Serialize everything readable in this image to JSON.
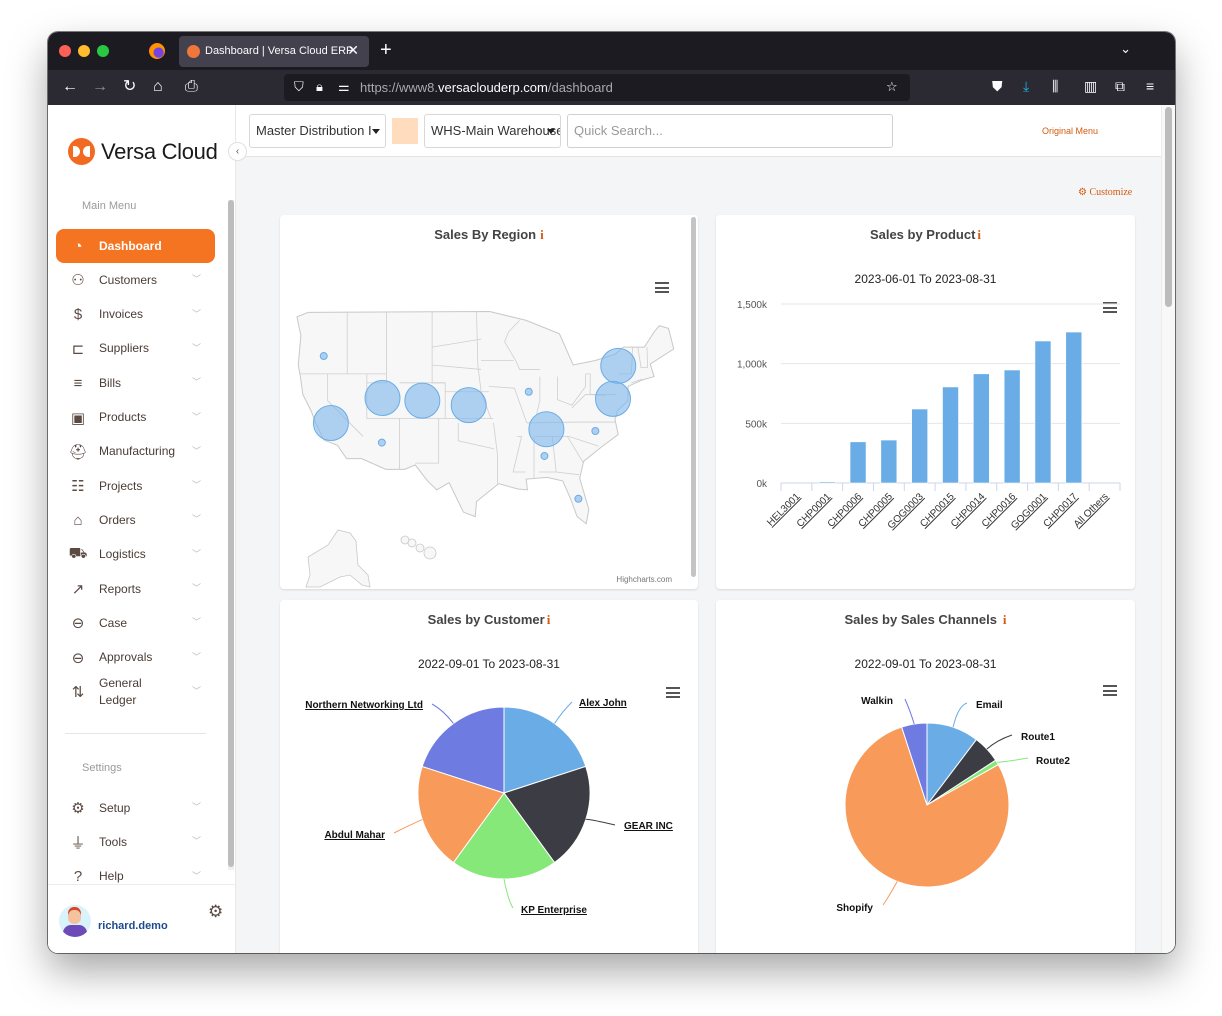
{
  "browser": {
    "tab_title": "Dashboard | Versa Cloud ERP",
    "tab_close": "✕",
    "new_tab": "+",
    "url_prefix": "https://www8.",
    "url_domain": "versaclouderp.com",
    "url_path": "/dashboard",
    "icons": [
      "back-icon",
      "forward-icon",
      "reload-icon",
      "home-icon",
      "print-icon",
      "shield-icon",
      "lock-icon",
      "permissions-icon",
      "bookmark-star-icon",
      "pocket-icon",
      "downloads-icon",
      "library-icon",
      "reader-view-icon",
      "extensions-icon",
      "menu-icon"
    ]
  },
  "sidebar": {
    "brand": "Versa Cloud",
    "main_menu_header": "Main Menu",
    "settings_header": "Settings",
    "main_items": [
      {
        "label": "Dashboard",
        "icon": "dashboard-gauge-icon",
        "glyph": "◔",
        "active": true
      },
      {
        "label": "Customers",
        "icon": "person-icon",
        "glyph": "⚇"
      },
      {
        "label": "Invoices",
        "icon": "invoice-dollar-icon",
        "glyph": "$"
      },
      {
        "label": "Suppliers",
        "icon": "hand-truck-icon",
        "glyph": "⊏"
      },
      {
        "label": "Bills",
        "icon": "bill-edit-icon",
        "glyph": "≡"
      },
      {
        "label": "Products",
        "icon": "box-icon",
        "glyph": "▣"
      },
      {
        "label": "Manufacturing",
        "icon": "hardhat-icon",
        "glyph": "⛑"
      },
      {
        "label": "Projects",
        "icon": "clipboard-icon",
        "glyph": "☷"
      },
      {
        "label": "Orders",
        "icon": "basket-icon",
        "glyph": "⌂"
      },
      {
        "label": "Logistics",
        "icon": "truck-icon",
        "glyph": "⛟"
      },
      {
        "label": "Reports",
        "icon": "chart-trend-icon",
        "glyph": "↗"
      },
      {
        "label": "Case",
        "icon": "folder-icon",
        "glyph": "⊖"
      },
      {
        "label": "Approvals",
        "icon": "folder-icon",
        "glyph": "⊖"
      },
      {
        "label": "General Ledger",
        "icon": "ledger-exchange-icon",
        "glyph": "⇅"
      }
    ],
    "settings_items": [
      {
        "label": "Setup",
        "icon": "gear-icon",
        "glyph": "⚙"
      },
      {
        "label": "Tools",
        "icon": "plug-icon",
        "glyph": "⏚"
      },
      {
        "label": "Help",
        "icon": "question-icon",
        "glyph": "?"
      }
    ],
    "user": {
      "name": "richard.demo"
    }
  },
  "topbar": {
    "company_select": "Master Distribution I",
    "warehouse_select": "WHS-Main Warehouse",
    "search_placeholder": "Quick Search...",
    "swatch_color": "#ffdcbd",
    "original_menu": "Original Menu",
    "customize": "Customize"
  },
  "widgets": {
    "region": {
      "title": "Sales By Region",
      "info": "i",
      "credit": "Highcharts.com"
    },
    "product": {
      "title": "Sales by Product",
      "info": "i"
    },
    "customer": {
      "title": "Sales by Customer",
      "info": "i"
    },
    "channels": {
      "title": "Sales by Sales Channels",
      "info": "i"
    }
  },
  "chart_data": [
    {
      "type": "scatter",
      "subtype": "map-bubble",
      "title": "Sales By Region",
      "map": "United States",
      "series": [
        {
          "name": "California",
          "size": "large",
          "lon": -119.5,
          "lat": 36.5
        },
        {
          "name": "Utah",
          "size": "large",
          "lon": -111.6,
          "lat": 39.3
        },
        {
          "name": "Colorado",
          "size": "large",
          "lon": -105.5,
          "lat": 39.0
        },
        {
          "name": "Kansas",
          "size": "large",
          "lon": -98.4,
          "lat": 38.5
        },
        {
          "name": "Tennessee",
          "size": "large",
          "lon": -86.5,
          "lat": 35.8
        },
        {
          "name": "New York",
          "size": "large",
          "lon": -75.5,
          "lat": 42.9
        },
        {
          "name": "Maryland/Delaware",
          "size": "large",
          "lon": -76.3,
          "lat": 39.2
        },
        {
          "name": "Oregon",
          "size": "small",
          "lon": -120.6,
          "lat": 44.0
        },
        {
          "name": "Arizona",
          "size": "small",
          "lon": -111.7,
          "lat": 34.3
        },
        {
          "name": "Illinois",
          "size": "small",
          "lon": -89.2,
          "lat": 40.0
        },
        {
          "name": "Alabama",
          "size": "small",
          "lon": -86.8,
          "lat": 32.8
        },
        {
          "name": "North Carolina",
          "size": "small",
          "lon": -79.0,
          "lat": 35.6
        },
        {
          "name": "Florida",
          "size": "small",
          "lon": -81.6,
          "lat": 28.0
        }
      ],
      "color": "#7cb5ec"
    },
    {
      "type": "bar",
      "title": "Sales by Product",
      "subtitle": "2023-06-01 To 2023-08-31",
      "categories": [
        "HEL3001",
        "CHP0001",
        "CHP0006",
        "CHP0005",
        "GOG0003",
        "CHP0015",
        "CHP0014",
        "CHP0016",
        "GOG0001",
        "CHP0017",
        "All Others"
      ],
      "values": [
        0,
        10,
        345,
        360,
        620,
        805,
        915,
        947,
        1190,
        1265,
        0
      ],
      "unit": "k",
      "yticks": [
        "0k",
        "500k",
        "1,000k",
        "1,500k"
      ],
      "ylim": [
        0,
        1500
      ],
      "color": "#6aace6",
      "grid": true
    },
    {
      "type": "pie",
      "title": "Sales by Customer",
      "subtitle": "2022-09-01 To 2023-08-31",
      "slices": [
        {
          "label": "Alex John",
          "value": 20,
          "color": "#6aace6"
        },
        {
          "label": "GEAR INC",
          "value": 20,
          "color": "#3c3c44"
        },
        {
          "label": "KP Enterprise",
          "value": 20,
          "color": "#87e87a"
        },
        {
          "label": "Abdul Mahar",
          "value": 20,
          "color": "#f89a5a"
        },
        {
          "label": "Northern Networking Ltd",
          "value": 20,
          "color": "#6e7be0"
        }
      ]
    },
    {
      "type": "pie",
      "title": "Sales by Sales Channels",
      "subtitle": "2022-09-01 To 2023-08-31",
      "slices": [
        {
          "label": "Email",
          "value": 10.3,
          "color": "#6aace6"
        },
        {
          "label": "Route1",
          "value": 5.5,
          "color": "#3c3c44"
        },
        {
          "label": "Route2",
          "value": 1.0,
          "color": "#87e87a"
        },
        {
          "label": "Shopify",
          "value": 78.2,
          "color": "#f89a5a"
        },
        {
          "label": "Walkin",
          "value": 5.0,
          "color": "#6e7be0"
        }
      ]
    }
  ]
}
